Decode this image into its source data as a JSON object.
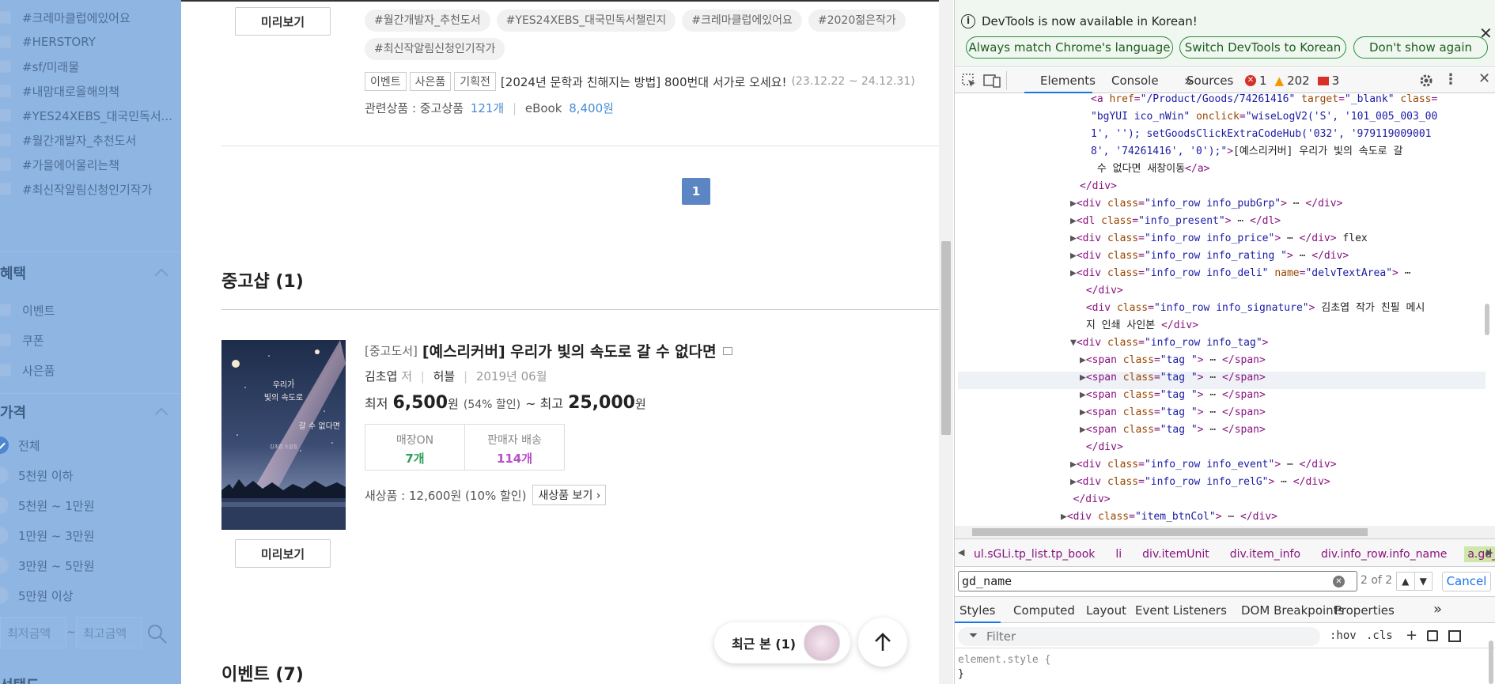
{
  "sidebar": {
    "tags": [
      "#크레마클럽에있어요",
      "#HERSTORY",
      "#sf/미래물",
      "#내맘대로올해의책",
      "#YES24XEBS_대국민독서...",
      "#월간개발자_추천도서",
      "#가을에어울리는책",
      "#최신작알림신청인기작가"
    ],
    "benefits_title": "혜택",
    "benefits": [
      "이벤트",
      "쿠폰",
      "사은품"
    ],
    "price_title": "가격",
    "prices": [
      "전체",
      "5천원 이하",
      "5천원 ~ 1만원",
      "1만원 ~ 3만원",
      "3만원 ~ 5만원",
      "5만원 이상"
    ],
    "min_price_placeholder": "최저금액",
    "max_price_placeholder": "최고금액",
    "tilde": "~",
    "bottom_title": "선택도"
  },
  "main": {
    "preview_label": "미리보기",
    "hashtags_row1": [
      "#월간개발자_추천도서",
      "#YES24XEBS_대국민독서챌린지",
      "#크레마클럽에있어요",
      "#2020젊은작가"
    ],
    "hashtags_row2": [
      "#최신작알림신청인기작가"
    ],
    "event_badges": [
      "이벤트",
      "사은품",
      "기획전"
    ],
    "event_text": "[2024년 문학과 친해지는 방법] 800번대 서가로 오세요!",
    "event_dates": "(23.12.22 ~ 24.12.31)",
    "related_label": "관련상품 : 중고상품",
    "related_used_count": "121개",
    "related_ebook_label": "eBook",
    "related_ebook_price": "8,400원",
    "page_number": "1",
    "used_shop_title": "중고샵 (1)",
    "book": {
      "category": "[중고도서]",
      "title": "[예스리커버] 우리가 빛의 속도로 갈 수 없다면",
      "author": "김초엽",
      "author_role": "저",
      "publisher": "허블",
      "date": "2019년 06월",
      "min_label": "최저",
      "min_price": "6,500",
      "won": "원",
      "discount": "(54% 할인)",
      "max_label": "~ 최고",
      "max_price": "25,000",
      "store_label": "매장ON",
      "store_count": "7개",
      "seller_label": "판매자 배송",
      "seller_count": "114개",
      "new_label": "새상품 : 12,600원 (10% 할인)",
      "new_button": "새상품 보기",
      "cover_line1": "우리가",
      "cover_line2": "빛의 속도로",
      "cover_line3": "갈 수 없다면",
      "cover_author": "김초엽 소설집"
    },
    "events_title": "이벤트 (7)",
    "recent_label": "최근 본 (1)"
  },
  "devtools": {
    "info_text": "DevTools is now available in Korean!",
    "btn_match": "Always match Chrome's language",
    "btn_switch": "Switch DevTools to Korean",
    "btn_dont": "Don't show again",
    "tabs": [
      "Elements",
      "Console",
      "Sources"
    ],
    "more_tabs": "»",
    "err_count": "1",
    "warn_count": "202",
    "issue_count": "3",
    "code_lines": [
      {
        "indent": 0,
        "html": "<span>&lt;a </span><span class='an'>href</span>=<span class='av'>\"/Product/Goods/74261416\"</span> <span class='an'>target</span>=<span class='av'>\"_blank\"</span> <span class='an'>class</span>="
      },
      {
        "indent": 1,
        "html": "<span class='av'>\"bgYUI ico_nWin\"</span> <span class='an'>onclick</span>=<span class='av'>\"wiseLogV2('S', '101_005_003_00</span>"
      },
      {
        "indent": 1,
        "html": "<span class='av'>1', ''); setGoodsClickExtraCodeHub('032', '979119009001</span>"
      },
      {
        "indent": 1,
        "html": "<span class='av'>8', '74261416', '0');\"</span>&gt;<span class='tx'>[예스리커버] 우리가 빛의 속도로 갈</span>"
      },
      {
        "indent": 1,
        "html": "<span class='tx'> 수 없다면 새창이동</span>&lt;/a&gt;"
      },
      {
        "indent": 2,
        "html": "&lt;/div&gt;"
      },
      {
        "indent": 3,
        "html": "<span class='tri'>▶</span>&lt;div <span class='an'>class</span>=<span class='av'>\"info_row info_pubGrp\"</span>&gt; <span class='tx'>⋯</span> &lt;/div&gt;"
      },
      {
        "indent": 3,
        "html": "<span class='tri'>▶</span>&lt;dl <span class='an'>class</span>=<span class='av'>\"info_present\"</span>&gt; <span class='tx'>⋯</span> &lt;/dl&gt;"
      },
      {
        "indent": 3,
        "html": "<span class='tri'>▶</span>&lt;div <span class='an'>class</span>=<span class='av'>\"info_row info_price\"</span>&gt; <span class='tx'>⋯</span> &lt;/div&gt; <span class='tx'>flex</span>"
      },
      {
        "indent": 3,
        "html": "<span class='tri'>▶</span>&lt;div <span class='an'>class</span>=<span class='av'>\"info_row info_rating \"</span>&gt; <span class='tx'>⋯</span> &lt;/div&gt;"
      },
      {
        "indent": 3,
        "html": "<span class='tri'>▶</span>&lt;div <span class='an'>class</span>=<span class='av'>\"info_row info_deli\"</span> <span class='an'>name</span>=<span class='av'>\"delvTextArea\"</span>&gt; <span class='tx'>⋯</span>"
      },
      {
        "indent": 2,
        "html": " &lt;/div&gt;"
      },
      {
        "indent": 2,
        "html": " &lt;div <span class='an'>class</span>=<span class='av'>\"info_row info_signature\"</span>&gt; <span class='tx'>김초엽 작가 친필 메시</span>"
      },
      {
        "indent": 2,
        "html": " <span class='tx'>지 인쇄 사인본 </span>&lt;/div&gt;"
      },
      {
        "indent": 3,
        "html": "<span class='tri'>▼</span>&lt;div <span class='an'>class</span>=<span class='av'>\"info_row info_tag\"</span>&gt;"
      },
      {
        "indent": 4,
        "html": "<span class='tri'>▶</span>&lt;span <span class='an'>class</span>=<span class='av'>\"tag \"</span>&gt; <span class='tx'>⋯</span> &lt;/span&gt;"
      },
      {
        "indent": 4,
        "html": "<span class='tri'>▶</span>&lt;span <span class='an'>class</span>=<span class='av'>\"tag \"</span>&gt; <span class='tx'>⋯</span> &lt;/span&gt;"
      },
      {
        "indent": 4,
        "html": "<span class='tri'>▶</span>&lt;span <span class='an'>class</span>=<span class='av'>\"tag \"</span>&gt; <span class='tx'>⋯</span> &lt;/span&gt;"
      },
      {
        "indent": 4,
        "html": "<span class='tri'>▶</span>&lt;span <span class='an'>class</span>=<span class='av'>\"tag \"</span>&gt; <span class='tx'>⋯</span> &lt;/span&gt;"
      },
      {
        "indent": 4,
        "html": "<span class='tri'>▶</span>&lt;span <span class='an'>class</span>=<span class='av'>\"tag \"</span>&gt; <span class='tx'>⋯</span> &lt;/span&gt;"
      },
      {
        "indent": 2,
        "html": " &lt;/div&gt;"
      },
      {
        "indent": 3,
        "html": "<span class='tri'>▶</span>&lt;div <span class='an'>class</span>=<span class='av'>\"info_row info_event\"</span>&gt; <span class='tx'>⋯</span> &lt;/div&gt;"
      },
      {
        "indent": 3,
        "html": "<span class='tri'>▶</span>&lt;div <span class='an'>class</span>=<span class='av'>\"info_row info_relG\"</span>&gt; <span class='tx'>⋯</span> &lt;/div&gt;"
      },
      {
        "indent": 1,
        "html": "  &lt;/div&gt;"
      },
      {
        "indent": 1,
        "html": "<span class='tri'>▶</span>&lt;div <span class='an'>class</span>=<span class='av'>\"item_btnCol\"</span>&gt; <span class='tx'>⋯</span> &lt;/div&gt;"
      },
      {
        "indent": 0,
        "html": " &lt;/div&gt;"
      }
    ],
    "breadcrumbs": [
      "ul.sGLi.tp_list.tp_book",
      "li",
      "div.itemUnit",
      "div.item_info",
      "div.info_row.info_name",
      "a.gd_name"
    ],
    "search_value": "gd_name",
    "search_count": "2 of 2",
    "cancel_label": "Cancel",
    "style_tabs": [
      "Styles",
      "Computed",
      "Layout",
      "Event Listeners",
      "DOM Breakpoints",
      "Properties"
    ],
    "filter_placeholder": "Filter",
    "hov": ":hov",
    "cls": ".cls",
    "element_style": "element.style {",
    "close_brace": "}"
  }
}
